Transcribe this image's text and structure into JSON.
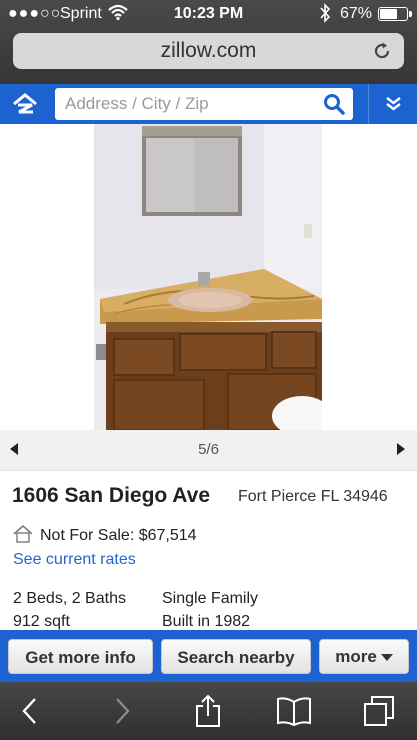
{
  "status_bar": {
    "signal": "●●●○○",
    "carrier": "Sprint",
    "time": "10:23 PM",
    "battery": "67%",
    "battery_level": 0.67
  },
  "browser": {
    "url": "zillow.com"
  },
  "search": {
    "placeholder": "Address / City / Zip"
  },
  "gallery": {
    "counter": "5/6"
  },
  "listing": {
    "street": "1606 San Diego Ave",
    "city": "Fort Pierce FL 34946",
    "status": "Not For Sale: $67,514",
    "rates_link": "See current rates",
    "beds_baths": "2 Beds, 2 Baths",
    "sqft": "912 sqft",
    "home_type": "Single Family",
    "year_built": "Built in 1982"
  },
  "actions": {
    "get_info": "Get more info",
    "search_nearby": "Search nearby",
    "more": "more"
  },
  "colors": {
    "brand_blue": "#1c62d0",
    "link_blue": "#2168c9"
  },
  "icons": [
    "wifi-icon",
    "bluetooth-icon",
    "battery-icon",
    "reload-icon",
    "zillow-logo-icon",
    "search-icon",
    "chevron-down-icon",
    "house-icon",
    "back-icon",
    "forward-icon",
    "share-icon",
    "bookmarks-icon",
    "tabs-icon"
  ]
}
